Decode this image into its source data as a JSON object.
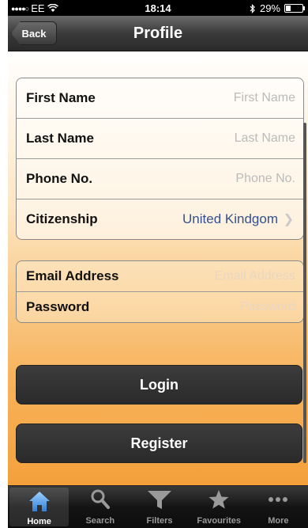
{
  "status_bar": {
    "carrier": "EE",
    "time": "18:14",
    "battery_percent": "29%",
    "battery_level": 0.29
  },
  "nav": {
    "back_label": "Back",
    "title": "Profile"
  },
  "personal_fields": {
    "first_name": {
      "label": "First Name",
      "placeholder": "First Name"
    },
    "last_name": {
      "label": "Last Name",
      "placeholder": "Last Name"
    },
    "phone": {
      "label": "Phone No.",
      "placeholder": "Phone No."
    },
    "citizenship": {
      "label": "Citizenship",
      "value": "United Kindgom"
    }
  },
  "account_fields": {
    "email": {
      "label": "Email Address",
      "placeholder": "Email Address"
    },
    "password": {
      "label": "Password",
      "placeholder": "Password"
    }
  },
  "buttons": {
    "login": "Login",
    "register": "Register"
  },
  "tabs": [
    {
      "label": "Home",
      "icon": "home-icon",
      "active": true
    },
    {
      "label": "Search",
      "icon": "search-icon",
      "active": false
    },
    {
      "label": "Filters",
      "icon": "filter-icon",
      "active": false
    },
    {
      "label": "Favourites",
      "icon": "star-icon",
      "active": false
    },
    {
      "label": "More",
      "icon": "more-icon",
      "active": false
    }
  ],
  "colors": {
    "accent_orange": "#f3a03a",
    "value_blue": "#34508f"
  }
}
